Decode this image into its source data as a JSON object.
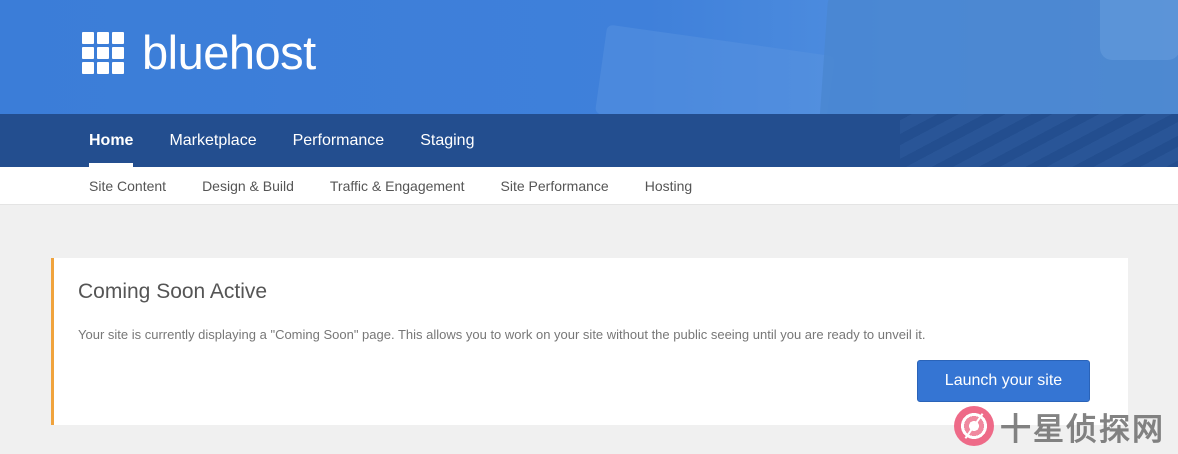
{
  "brand": {
    "name": "bluehost"
  },
  "main_nav": {
    "items": [
      {
        "label": "Home",
        "active": true
      },
      {
        "label": "Marketplace",
        "active": false
      },
      {
        "label": "Performance",
        "active": false
      },
      {
        "label": "Staging",
        "active": false
      }
    ]
  },
  "sub_nav": {
    "items": [
      {
        "label": "Site Content"
      },
      {
        "label": "Design & Build"
      },
      {
        "label": "Traffic & Engagement"
      },
      {
        "label": "Site Performance"
      },
      {
        "label": "Hosting"
      }
    ]
  },
  "coming_soon": {
    "title": "Coming Soon Active",
    "description": "Your site is currently displaying a \"Coming Soon\" page. This allows you to work on your site without the public seeing until you are ready to unveil it.",
    "button_label": "Launch your site"
  },
  "watermark": {
    "text": "十星侦探网",
    "icon": "target-icon"
  },
  "colors": {
    "header_blue": "#3b7dd8",
    "nav_dark_blue": "#234e8f",
    "accent_orange": "#f0a33d",
    "button_blue": "#3575d3"
  }
}
